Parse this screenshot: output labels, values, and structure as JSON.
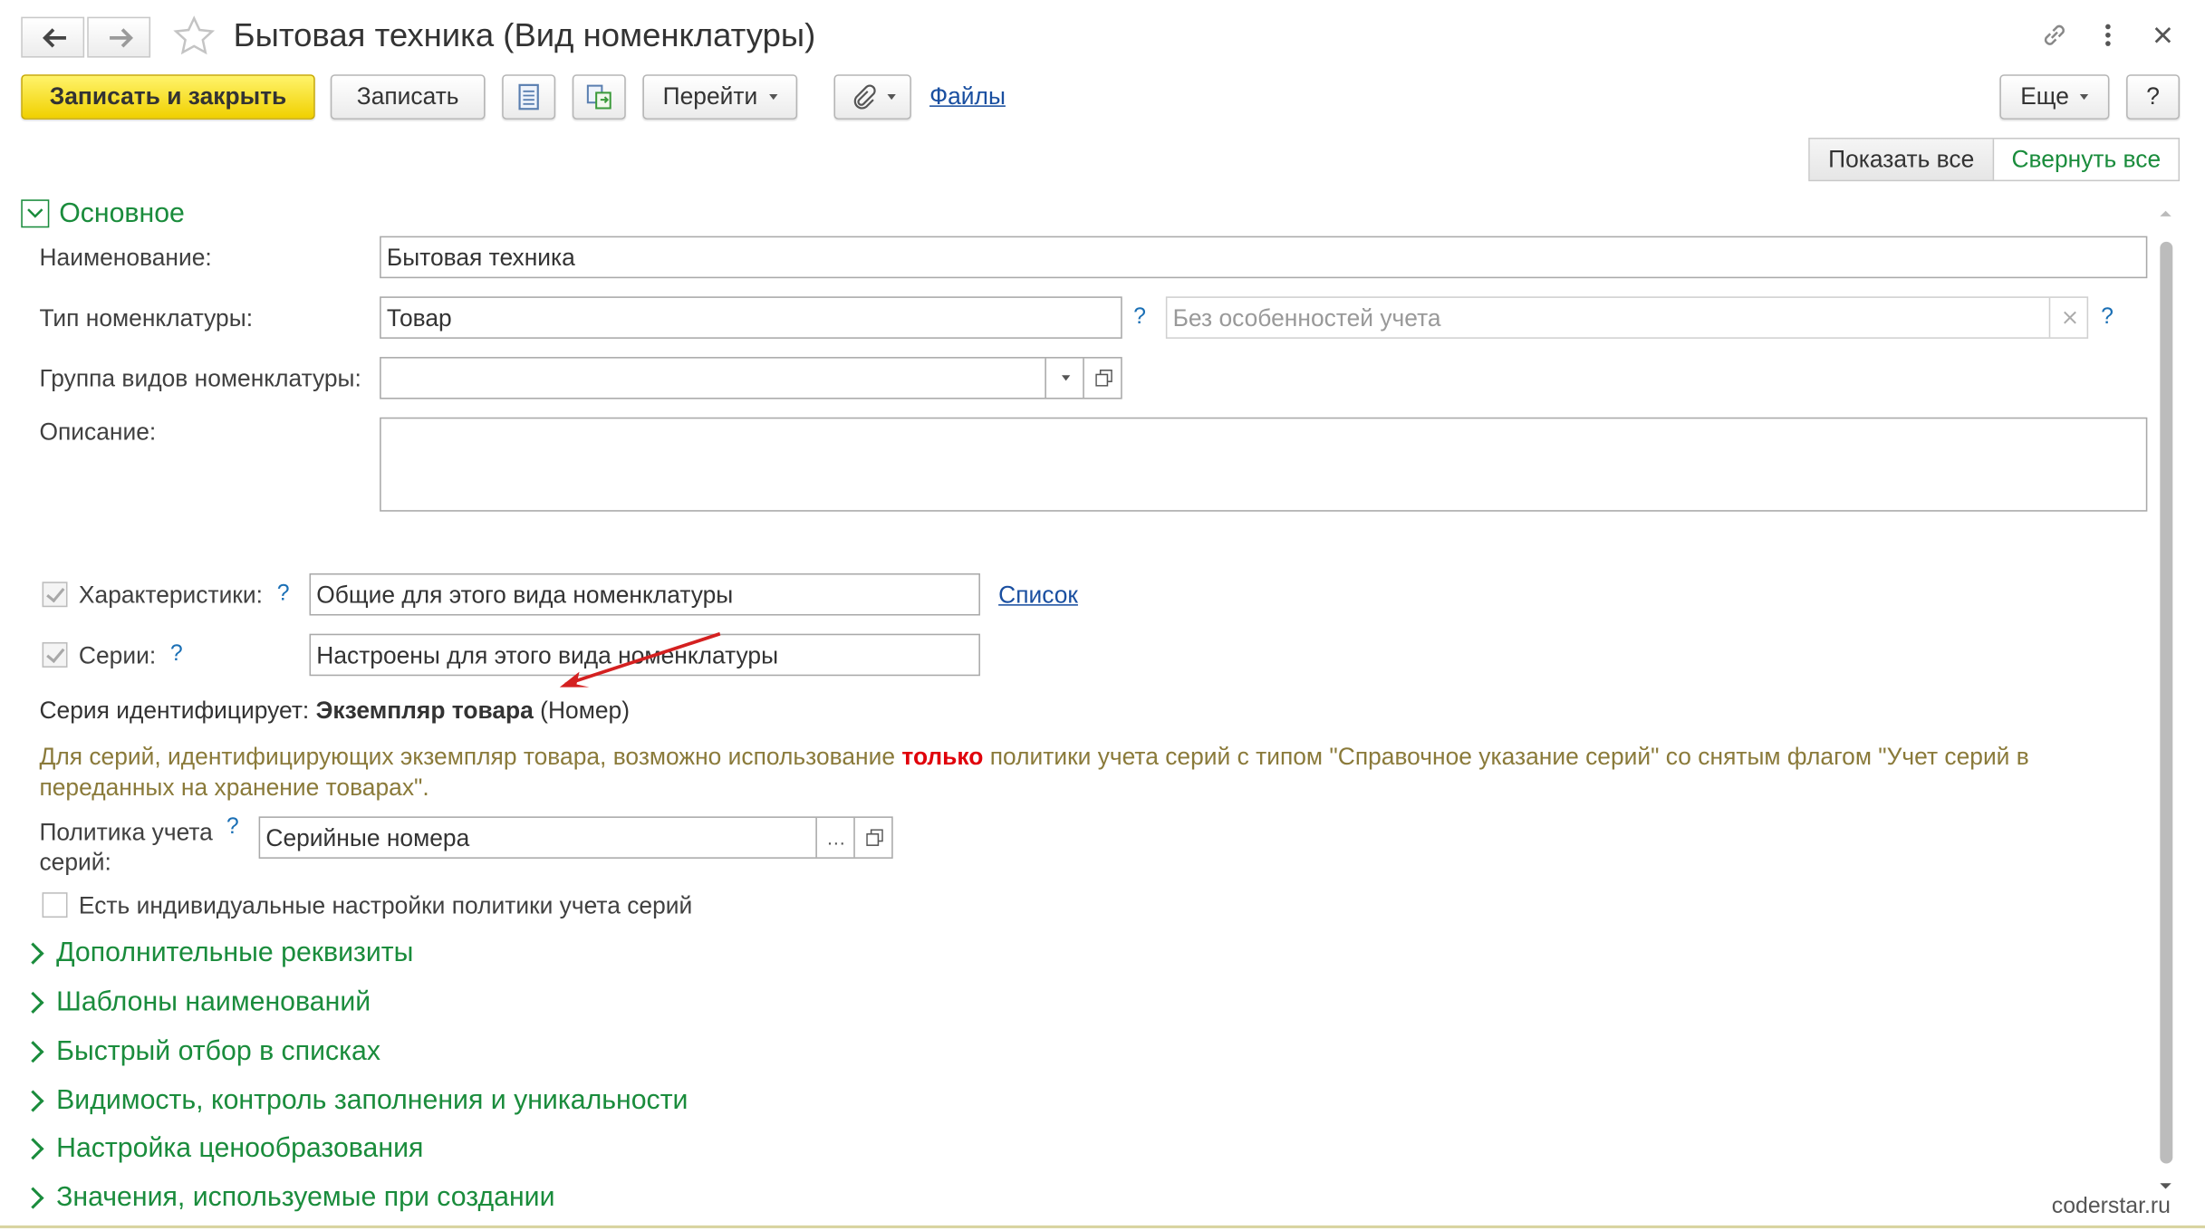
{
  "window": {
    "title": "Бытовая техника (Вид номенклатуры)"
  },
  "toolbar": {
    "save_close_label": "Записать и закрыть",
    "save_label": "Записать",
    "goto_label": "Перейти",
    "files_label": "Файлы",
    "more_label": "Еще",
    "help_label": "?"
  },
  "view_toggle": {
    "show_all_label": "Показать все",
    "collapse_all_label": "Свернуть все"
  },
  "main_group": {
    "title": "Основное",
    "name_label": "Наименование:",
    "name_value": "Бытовая техника",
    "type_label": "Тип номенклатуры:",
    "type_value": "Товар",
    "accounting_placeholder": "Без особенностей учета",
    "group_label": "Группа видов номенклатуры:",
    "group_value": "",
    "description_label": "Описание:",
    "description_value": "",
    "help_mark": "?"
  },
  "characteristics": {
    "label": "Характеристики:",
    "value": "Общие для этого вида номенклатуры",
    "list_link": "Список"
  },
  "series": {
    "label": "Серии:",
    "value": "Настроены для этого вида номенклатуры",
    "identifies_label": "Серия идентифицирует:",
    "identifies_value": "Экземпляр товара",
    "identifies_suffix": "(Номер)",
    "note_before": "Для серий, идентифицирующих экземпляр товара, возможно использование",
    "note_emphasis": "только",
    "note_after_line1": "политики учета серий с типом \"Справочное указание серий\" со снятым флагом \"Учет серий в",
    "note_line2": "переданных на хранение товарах\".",
    "policy_label_line1": "Политика учета",
    "policy_label_line2": "серий:",
    "policy_value": "Серийные номера",
    "individual_settings_label": "Есть индивидуальные настройки политики учета серий"
  },
  "sections": [
    "Дополнительные реквизиты",
    "Шаблоны наименований",
    "Быстрый отбор в списках",
    "Видимость, контроль заполнения и уникальности",
    "Настройка ценообразования",
    "Значения, используемые при создании"
  ],
  "watermark": "coderstar.ru",
  "colors": {
    "primary_button": "#f5dc1e",
    "section_title": "#1a8c3c",
    "link": "#1a4fa0",
    "note_text": "#8a7a3a",
    "emphasis": "#e0000a",
    "annotation_arrow": "#d42020"
  }
}
